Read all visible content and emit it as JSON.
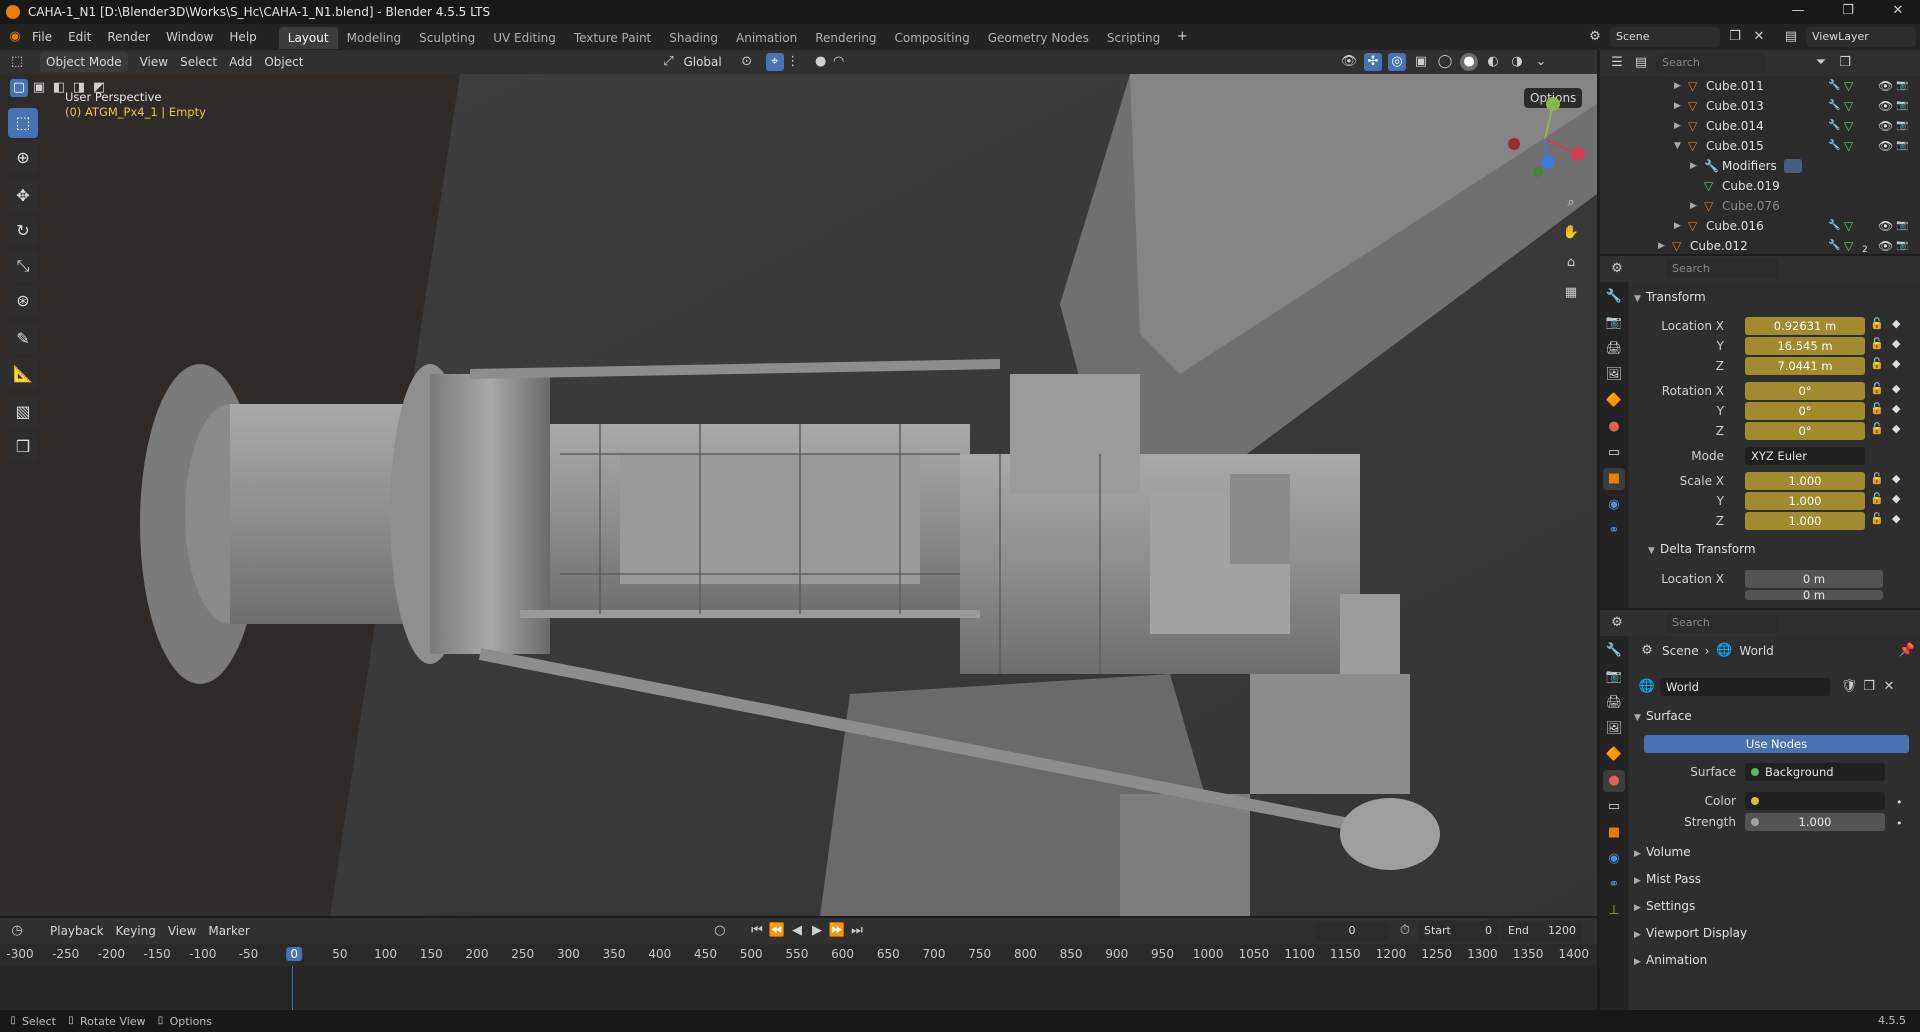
{
  "window": {
    "title": "CAHA-1_N1 [D:\\Blender3D\\Works\\S_Hc\\CAHA-1_N1.blend] - Blender 4.5.5 LTS",
    "controls": [
      "—",
      "❐",
      "✕"
    ]
  },
  "menu": [
    "File",
    "Edit",
    "Render",
    "Window",
    "Help"
  ],
  "workspaces": [
    "Layout",
    "Modeling",
    "Sculpting",
    "UV Editing",
    "Texture Paint",
    "Shading",
    "Animation",
    "Rendering",
    "Compositing",
    "Geometry Nodes",
    "Scripting"
  ],
  "active_workspace": "Layout",
  "scene_name": "Scene",
  "view_layer": "ViewLayer",
  "viewport_header": {
    "mode": "Object Mode",
    "menus": [
      "View",
      "Select",
      "Add",
      "Object"
    ],
    "orientation": "Global",
    "options": "Options"
  },
  "viewport": {
    "perspective": "User Perspective",
    "active_object": "(0) ATGM_Px4_1 | Empty"
  },
  "outliner": {
    "search_placeholder": "Search",
    "rows": [
      {
        "name": "Cube.011",
        "dim": false
      },
      {
        "name": "Cube.013",
        "dim": false
      },
      {
        "name": "Cube.014",
        "dim": false
      },
      {
        "name": "Cube.015",
        "dim": false
      },
      {
        "name": "Modifiers",
        "dim": false
      },
      {
        "name": "Cube.019",
        "dim": false
      },
      {
        "name": "Cube.076",
        "dim": true
      },
      {
        "name": "Cube.016",
        "dim": false
      },
      {
        "name": "Cube.012",
        "dim": false
      }
    ],
    "badge": "2"
  },
  "properties_object": {
    "search_placeholder": "Search",
    "section_transform": "Transform",
    "labels": {
      "location_x": "Location X",
      "y": "Y",
      "z": "Z",
      "rotation_x": "Rotation X",
      "mode": "Mode",
      "scale_x": "Scale X"
    },
    "location": [
      "0.92631 m",
      "16.545 m",
      "7.0441 m"
    ],
    "rotation": [
      "0°",
      "0°",
      "0°"
    ],
    "rotation_mode": "XYZ Euler",
    "scale": [
      "1.000",
      "1.000",
      "1.000"
    ],
    "section_delta": "Delta Transform",
    "delta_location_label": "Location X",
    "delta_location": [
      "0 m",
      "0 m"
    ]
  },
  "properties_world": {
    "search_placeholder": "Search",
    "breadcrumb_scene": "Scene",
    "breadcrumb_world": "World",
    "world_name": "World",
    "section_surface": "Surface",
    "use_nodes": "Use Nodes",
    "surface_label": "Surface",
    "surface_value": "Background",
    "color_label": "Color",
    "strength_label": "Strength",
    "strength_value": "1.000",
    "collapsed_sections": [
      "Volume",
      "Mist Pass",
      "Settings",
      "Viewport Display",
      "Animation"
    ]
  },
  "timeline": {
    "menus": [
      "Playback",
      "Keying",
      "View",
      "Marker"
    ],
    "current_frame": "0",
    "start_label": "Start",
    "start_value": "0",
    "end_label": "End",
    "end_value": "1200",
    "ruler_ticks": [
      "-300",
      "-250",
      "-200",
      "-150",
      "-100",
      "-50",
      "0",
      "50",
      "100",
      "150",
      "200",
      "250",
      "300",
      "350",
      "400",
      "450",
      "500",
      "550",
      "600",
      "650",
      "700",
      "750",
      "800",
      "850",
      "900",
      "950",
      "1000",
      "1050",
      "1100",
      "1150",
      "1200",
      "1250",
      "1300",
      "1350",
      "1400"
    ],
    "current_tick": "0"
  },
  "statusbar": {
    "items": [
      "Select",
      "Rotate View",
      "Options"
    ],
    "version": "4.5.5"
  },
  "colors": {
    "accent": "#4772b3",
    "field_yellow": "#a28b2f",
    "blender_orange": "#e87d0d"
  }
}
